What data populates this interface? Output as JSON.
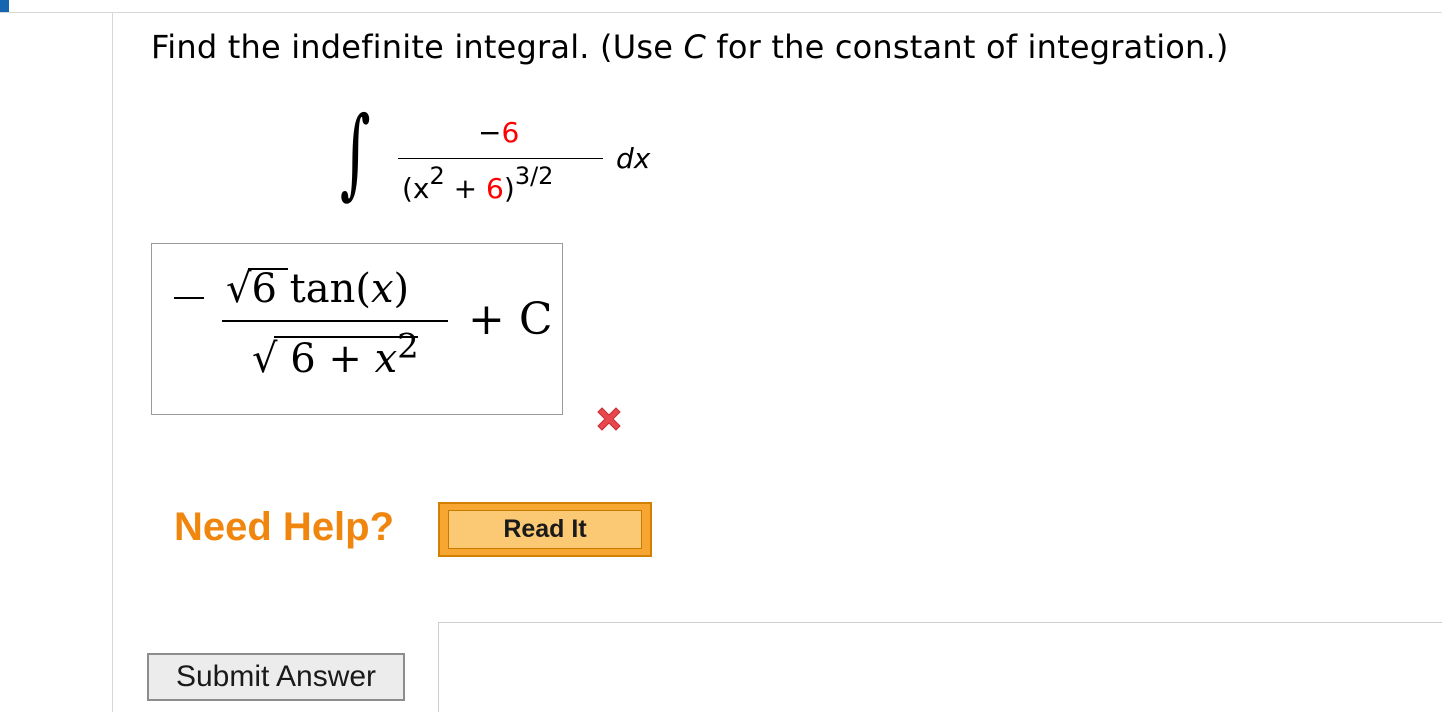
{
  "question": {
    "prompt_before": "Find the indefinite integral. (Use ",
    "prompt_var": "C",
    "prompt_after": " for the constant of integration.)"
  },
  "integral": {
    "numerator_sign": "−",
    "numerator_value": "6",
    "denominator_open": "(x",
    "denominator_exp": "2",
    "denominator_plus": " + ",
    "denominator_value": "6",
    "denominator_close": ")",
    "outer_exp": "3/2",
    "differential": "dx",
    "highlight_color": "#ff0000"
  },
  "answer": {
    "numerator_text": "√6 tan(",
    "numerator_var": "x",
    "numerator_close": ")",
    "denominator_text": "√ 6 + ",
    "denominator_var": "x",
    "denominator_exp": "2",
    "tail": "+ C",
    "status": "incorrect",
    "status_icon": "red-x-icon"
  },
  "help": {
    "label": "Need Help?",
    "read_it_label": "Read It"
  },
  "actions": {
    "submit_label": "Submit Answer"
  },
  "colors": {
    "accent": "#f0860e",
    "button": "#f7a632",
    "error": "#e8474d",
    "corner_mark": "#1565b0"
  }
}
